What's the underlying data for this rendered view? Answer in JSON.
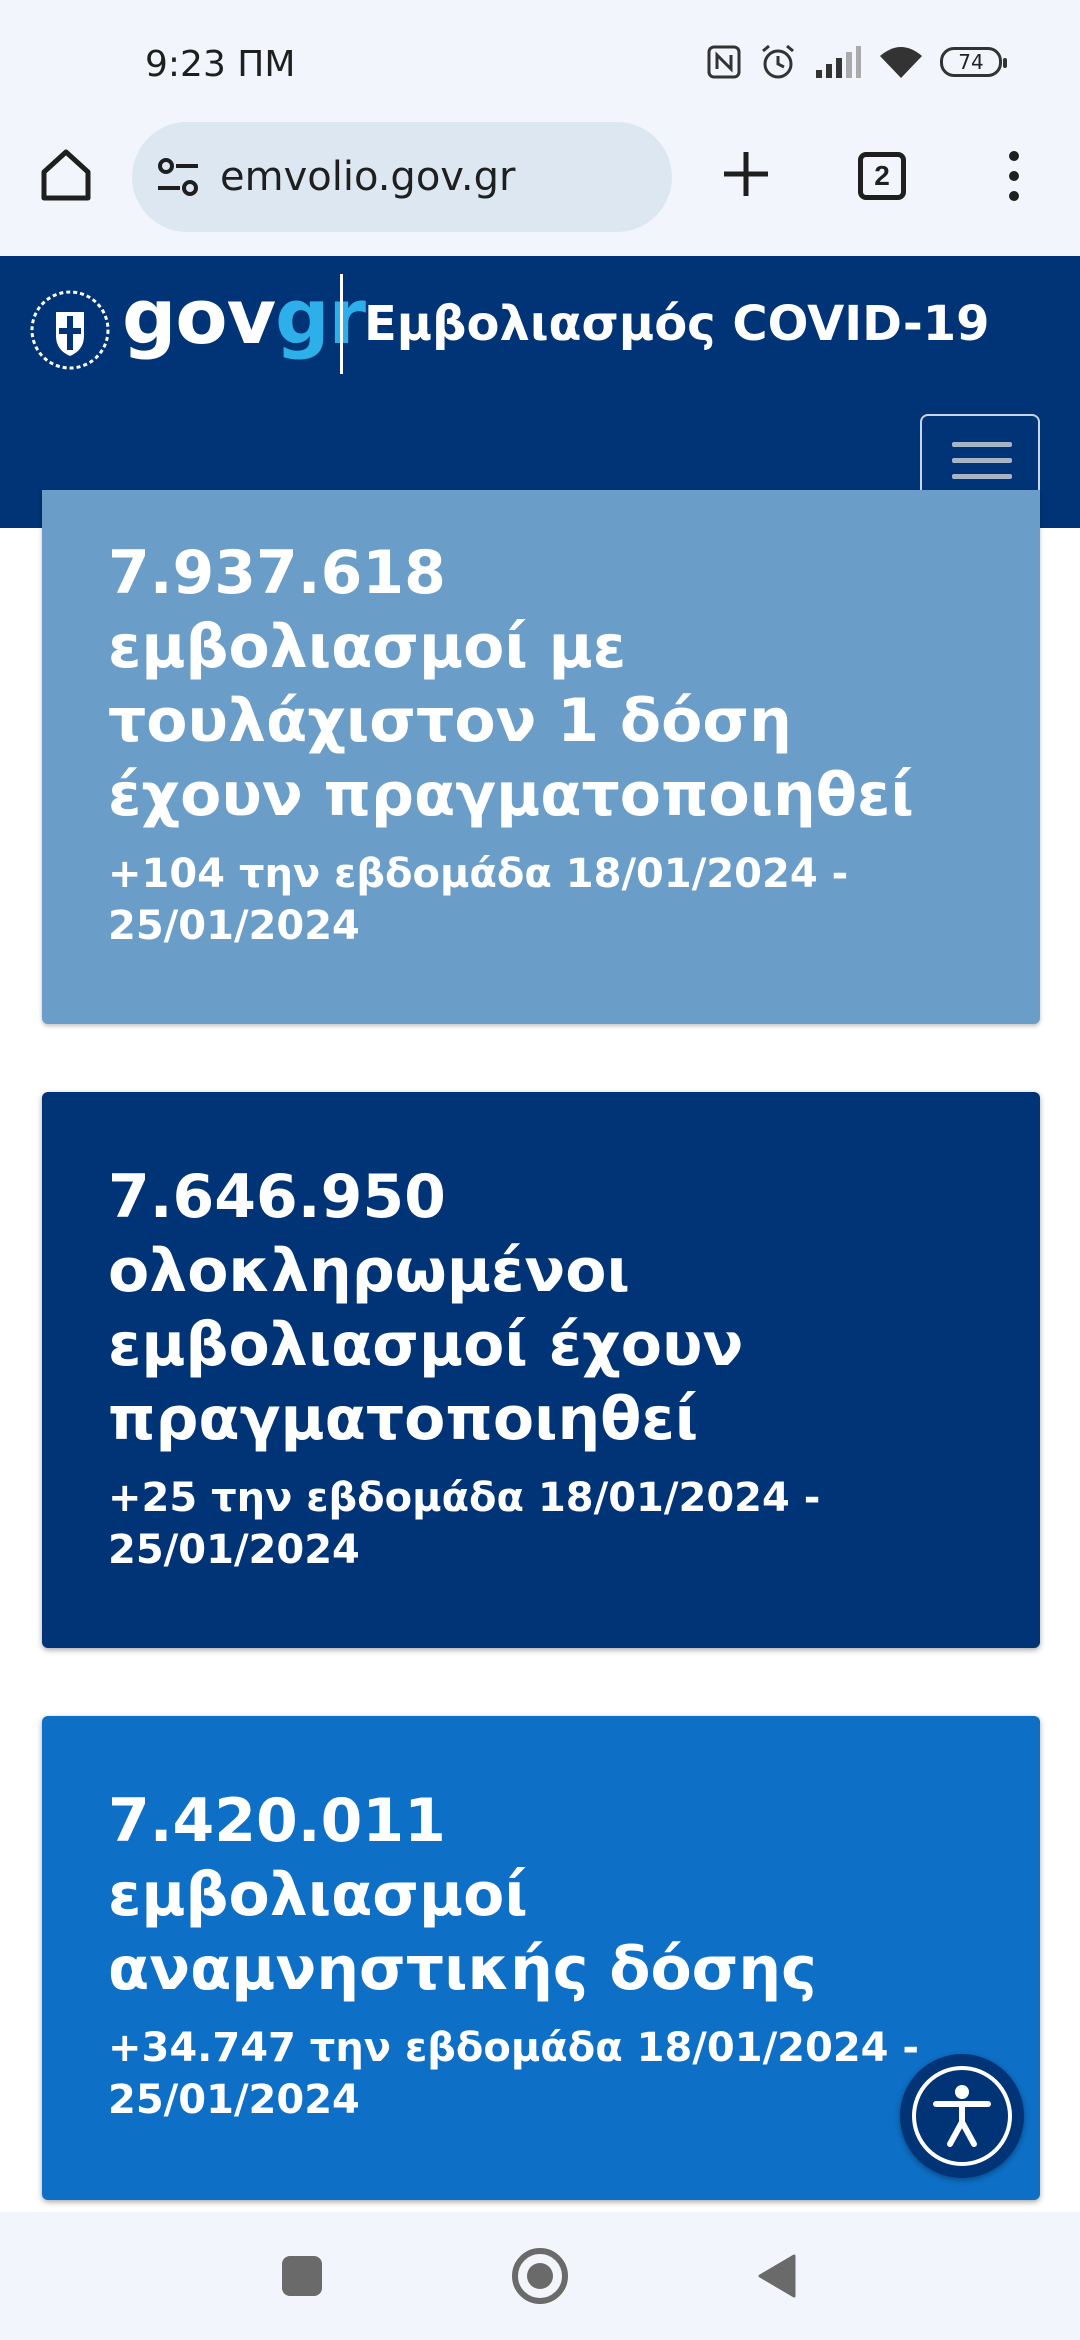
{
  "status_bar": {
    "time": "9:23 ΠΜ",
    "battery": "74",
    "icons": [
      "nfc-icon",
      "alarm-icon",
      "signal-icon",
      "wifi-icon",
      "battery-icon"
    ]
  },
  "browser": {
    "url": "emvolio.gov.gr",
    "tab_count": "2",
    "icons": [
      "home-icon",
      "site-settings-icon",
      "new-tab-icon",
      "tab-switcher-icon",
      "overflow-menu-icon"
    ]
  },
  "header": {
    "logo_gov": "gov",
    "logo_gr": "gr",
    "title": "Εμβολιασμός COVID-19",
    "colors": {
      "background": "#003476",
      "logo_accent": "#2db0ea"
    }
  },
  "cards": [
    {
      "value": "7.937.618",
      "desc_lines": [
        "εμβολιασμοί με",
        "τουλάχιστον 1 δόση",
        "έχουν πραγματοποιηθεί"
      ],
      "delta_lines": [
        "+104 την εβδομάδα 18/01/2024 -",
        "25/01/2024"
      ],
      "color": "#6a9ec8"
    },
    {
      "value": "7.646.950",
      "desc_lines": [
        "ολοκληρωμένοι",
        "εμβολιασμοί έχουν",
        "πραγματοποιηθεί"
      ],
      "delta_lines": [
        "+25 την εβδομάδα 18/01/2024 -",
        "25/01/2024"
      ],
      "color": "#003476"
    },
    {
      "value": "7.420.011",
      "desc_lines": [
        "εμβολιασμοί",
        "αναμνηστικής δόσης"
      ],
      "delta_lines": [
        "+34.747 την εβδομάδα 18/01/2024 -",
        "25/01/2024"
      ],
      "color": "#0d6fc6"
    }
  ],
  "accessibility_button_icon": "accessibility-icon",
  "nav_bar_icons": [
    "recents-icon",
    "home-nav-icon",
    "back-icon"
  ]
}
